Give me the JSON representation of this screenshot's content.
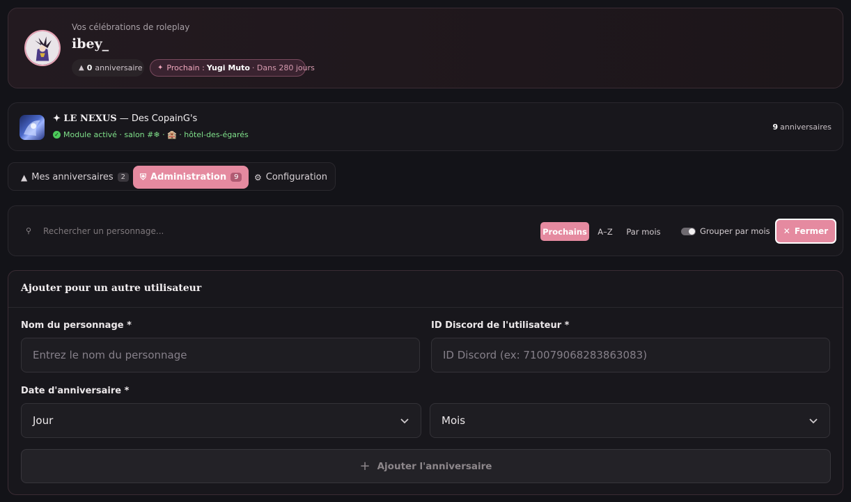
{
  "profile": {
    "subtitle": "Vos célébrations de roleplay",
    "username": "ibey_",
    "birthday_count": "0",
    "birthday_label": "anniversaire",
    "next_label": "Prochain :",
    "next_name": "Yugi Muto",
    "next_when": "· Dans 280 jours",
    "avatar_alt": "avatar"
  },
  "server": {
    "title_prefix": "✦ LE NEXUS",
    "title_suffix": "— Des CopainG's",
    "status": "Module activé · salon #❄ · 🏨 · hôtel-des-égarés",
    "count": "9",
    "count_label": "anniversaires"
  },
  "tabs": [
    {
      "label": "Mes anniversaires",
      "badge": "2",
      "icon": "cake-icon"
    },
    {
      "label": "Administration",
      "badge": "9",
      "icon": "shield-icon"
    },
    {
      "label": "Configuration",
      "icon": "gear-icon"
    }
  ],
  "search": {
    "placeholder": "Rechercher un personnage..."
  },
  "sort": {
    "prochains": "Prochains",
    "az": "A–Z",
    "par_mois": "Par mois"
  },
  "group_toggle": {
    "label": "Grouper par mois",
    "on": true
  },
  "close_button": "Fermer",
  "form": {
    "title": "Ajouter pour un autre utilisateur",
    "name_label": "Nom du personnage *",
    "name_placeholder": "Entrez le nom du personnage",
    "discord_label": "ID Discord de l'utilisateur *",
    "discord_placeholder": "ID Discord (ex: 710079068283863083)",
    "date_label": "Date d'anniversaire *",
    "day_value": "Jour",
    "month_value": "Mois",
    "submit_label": "Ajouter l'anniversaire"
  },
  "colors": {
    "accent": "#e58aa0",
    "status_green": "#7fe08a",
    "background": "#131318"
  }
}
